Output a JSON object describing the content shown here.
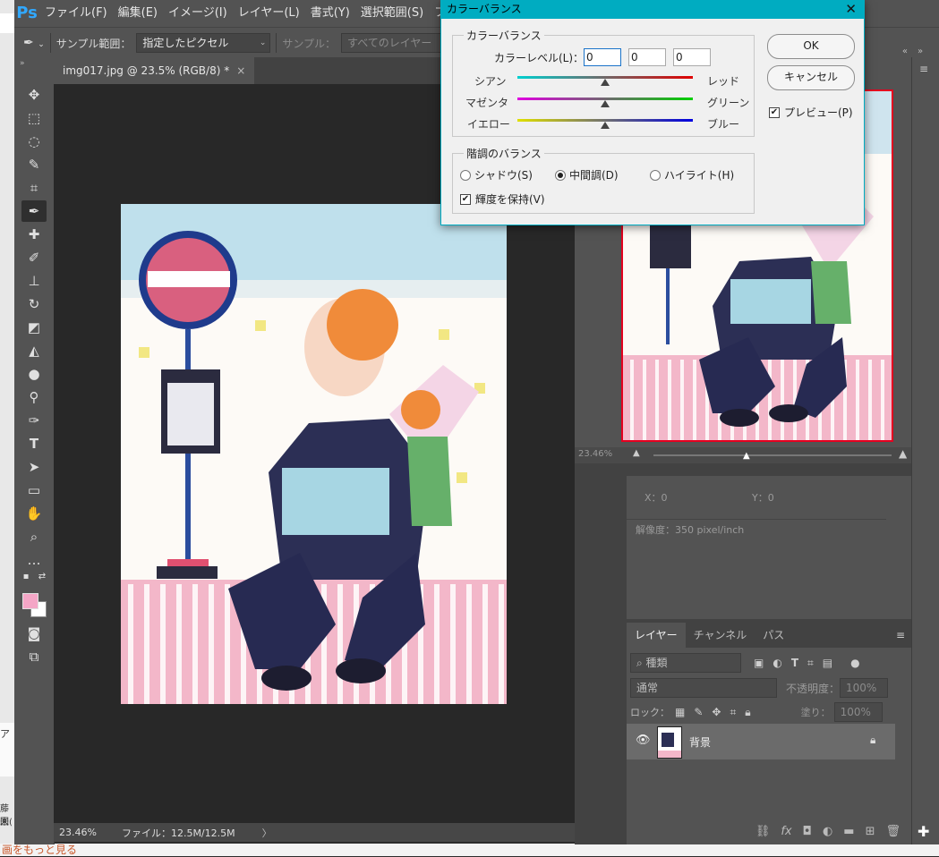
{
  "app": {
    "logo": "Ps"
  },
  "menu": {
    "items": [
      "ファイル(F)",
      "編集(E)",
      "イメージ(I)",
      "レイヤー(L)",
      "書式(Y)",
      "選択範囲(S)",
      "フィルター"
    ]
  },
  "options": {
    "sample_size_label": "サンプル範囲：",
    "sample_size_value": "指定したピクセル",
    "sample_label": "サンプル：",
    "sample_value": "すべてのレイヤー"
  },
  "document": {
    "tab_title": "img017.jpg @ 23.5% (RGB/8) *",
    "close_icon": "×",
    "zoom": "23.46%",
    "file_info": "ファイル：12.5M/12.5M",
    "status_arrow": "〉"
  },
  "navigator": {
    "zoom": "23.46%"
  },
  "info": {
    "x_label": "X：",
    "x_value": "0",
    "y_label": "Y：",
    "y_value": "0",
    "resolution": "解像度：350 pixel/inch"
  },
  "layers": {
    "tabs": [
      "レイヤー",
      "チャンネル",
      "パス"
    ],
    "kind_filter": "種類",
    "blend_mode": "通常",
    "opacity_label": "不透明度：",
    "opacity_value": "100%",
    "lock_label": "ロック：",
    "fill_label": "塗り：",
    "fill_value": "100%",
    "layer_name": "背景"
  },
  "dialog": {
    "title": "カラーバランス",
    "close": "✕",
    "color_balance_group": "カラーバランス",
    "color_levels_label": "カラーレベル(L)：",
    "levels": [
      "0",
      "0",
      "0"
    ],
    "sliders": [
      {
        "left": "シアン",
        "right": "レッド",
        "value": 0
      },
      {
        "left": "マゼンタ",
        "right": "グリーン",
        "value": 0
      },
      {
        "left": "イエロー",
        "right": "ブルー",
        "value": 0
      }
    ],
    "tone_group": "階調のバランス",
    "tones": [
      "シャドウ(S)",
      "中間調(D)",
      "ハイライト(H)"
    ],
    "selected_tone": "中間調(D)",
    "preserve_luminosity": "輝度を保持(V)",
    "preserve_checked": true,
    "ok": "OK",
    "cancel": "キャンセル",
    "preview": "プレビュー(P)",
    "preview_checked": true
  },
  "background_window": {
    "bottom_text": "画をもっと見る",
    "left_fragments": [
      "ア",
      "藤未",
      "回("
    ]
  },
  "colors": {
    "foreground": "#f4a6c6",
    "background": "#ffffff",
    "accent": "#00acc1"
  }
}
